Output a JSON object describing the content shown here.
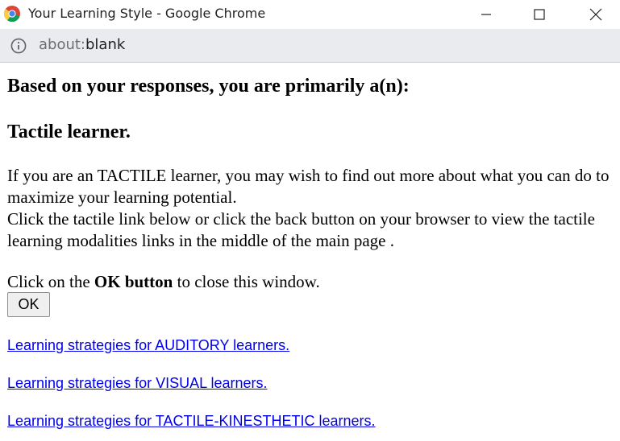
{
  "window": {
    "title": "Your Learning Style - Google Chrome",
    "icon": "chrome-icon"
  },
  "addressbar": {
    "icon": "info-icon",
    "url_scheme": "about:",
    "url_path": "blank"
  },
  "content": {
    "heading_primary": "Based on your responses, you are primarily a(n):",
    "heading_type": "Tactile learner.",
    "paragraph_line1": "If you are an TACTILE learner, you may wish to find out more about what you can do to maximize your learning potential.",
    "paragraph_line2": "Click the tactile link below or click the back button on your browser to view the tactile learning modalities links in the middle of the main page .",
    "close_prefix": "Click on the ",
    "close_bold": "OK button",
    "close_suffix": " to close this window.",
    "ok_button": "OK",
    "links": [
      "Learning strategies for AUDITORY learners.",
      "Learning strategies for VISUAL learners.",
      "Learning strategies for TACTILE-KINESTHETIC learners."
    ]
  },
  "colors": {
    "link": "#0000ee",
    "addressbar_bg": "#e9ebee",
    "button_bg": "#efefef"
  }
}
